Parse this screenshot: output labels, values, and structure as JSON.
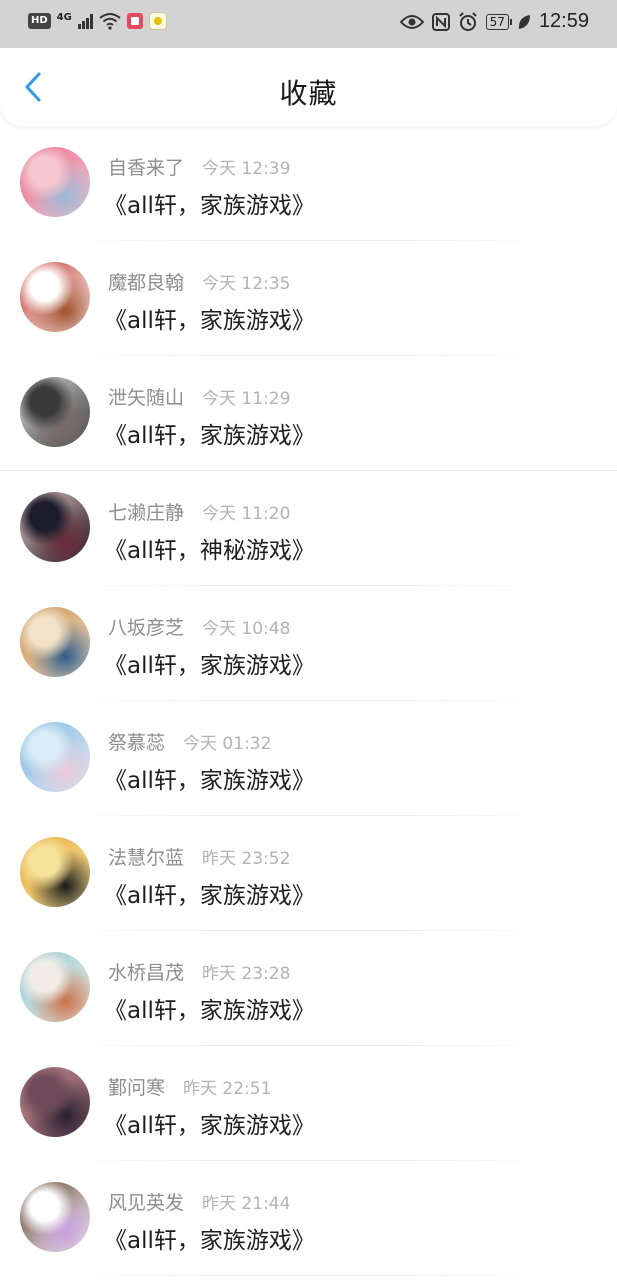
{
  "status_bar": {
    "hd": "HD",
    "network": "4G",
    "battery": "57",
    "time": "12:59",
    "icons": [
      "signal-icon",
      "wifi-icon",
      "app-notification-icon",
      "app-notification-icon",
      "eye-icon",
      "nfc-icon",
      "alarm-icon",
      "battery-icon",
      "leaf-icon"
    ]
  },
  "header": {
    "back_icon": "chevron-left-icon",
    "title": "收藏",
    "accent": "#2a9bf0"
  },
  "items": [
    {
      "author": "自香来了",
      "time": "今天 12:39",
      "title": "《all轩，家族游戏》",
      "avatar_colors": [
        "#f7c7d0",
        "#e56b8a",
        "#9bb9d8"
      ]
    },
    {
      "author": "魔都良翰",
      "time": "今天 12:35",
      "title": "《all轩，家族游戏》",
      "avatar_colors": [
        "#ffffff",
        "#c0392b",
        "#a0522d"
      ]
    },
    {
      "author": "泄矢随山",
      "time": "今天 11:29",
      "title": "《all轩，家族游戏》",
      "avatar_colors": [
        "#3a3a3a",
        "#dcdcdc",
        "#7a6a6a"
      ]
    },
    {
      "author": "七濑庄静",
      "time": "今天 11:20",
      "title": "《all轩，神秘游戏》",
      "avatar_colors": [
        "#1c1c2a",
        "#e9c7c0",
        "#6a2a3a"
      ]
    },
    {
      "author": "八坂彦芝",
      "time": "今天 10:48",
      "title": "《all轩，家族游戏》",
      "avatar_colors": [
        "#f2e2c8",
        "#c98a4b",
        "#2f5d8a"
      ]
    },
    {
      "author": "祭慕蕊",
      "time": "今天 01:32",
      "title": "《all轩，家族游戏》",
      "avatar_colors": [
        "#d9ecf7",
        "#7fb6df",
        "#e8c9d8"
      ]
    },
    {
      "author": "法慧尔蓝",
      "time": "昨天 23:52",
      "title": "《all轩，家族游戏》",
      "avatar_colors": [
        "#f6e39a",
        "#e7a83a",
        "#1a1a1a"
      ]
    },
    {
      "author": "水桥昌茂",
      "time": "昨天 23:28",
      "title": "《all轩，家族游戏》",
      "avatar_colors": [
        "#f1ede6",
        "#8cc8d0",
        "#c9714a"
      ]
    },
    {
      "author": "鄞问寒",
      "time": "昨天 22:51",
      "title": "《all轩，家族游戏》",
      "avatar_colors": [
        "#6e4a5a",
        "#c08a8a",
        "#2a2030"
      ]
    },
    {
      "author": "风见英发",
      "time": "昨天 21:44",
      "title": "《all轩，家族游戏》",
      "avatar_colors": [
        "#ffffff",
        "#5a3a2a",
        "#c9a0e0"
      ]
    }
  ]
}
